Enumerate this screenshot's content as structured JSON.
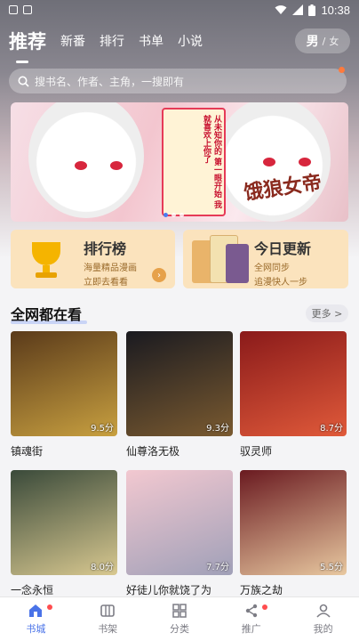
{
  "status_bar": {
    "time": "10:38"
  },
  "header": {
    "tabs": [
      {
        "label": "推荐",
        "active": true
      },
      {
        "label": "新番",
        "active": false
      },
      {
        "label": "排行",
        "active": false
      },
      {
        "label": "书单",
        "active": false
      },
      {
        "label": "小说",
        "active": false
      }
    ],
    "gender": {
      "male": "男",
      "separator": "/",
      "female": "女"
    }
  },
  "search": {
    "placeholder": "搜书名、作者、主角，一搜即有"
  },
  "banner": {
    "title_art": "饿狼女帝",
    "side_text": "从未知你的 第一眼开始 我就喜欢上你了"
  },
  "promos": [
    {
      "title": "排行榜",
      "line1": "海量精品漫画",
      "line2": "立即去看看"
    },
    {
      "title": "今日更新",
      "line1": "全网同步",
      "line2": "追漫快人一步"
    }
  ],
  "section": {
    "title": "全网都在看",
    "more": "更多 >"
  },
  "comics": [
    {
      "name": "镇魂街",
      "score": "9.5分",
      "colors": [
        "#5a3a1a",
        "#c8a040"
      ]
    },
    {
      "name": "仙尊洛无极",
      "score": "9.3分",
      "colors": [
        "#1a1a20",
        "#7a5a30"
      ]
    },
    {
      "name": "驭灵师",
      "score": "8.7分",
      "colors": [
        "#8a1a1a",
        "#e05a3a"
      ]
    },
    {
      "name": "一念永恒",
      "score": "8.0分",
      "colors": [
        "#3a4a3a",
        "#d8c890"
      ]
    },
    {
      "name": "好徒儿你就饶了为",
      "score": "7.7分",
      "colors": [
        "#f2c8d0",
        "#a0a0b8"
      ]
    },
    {
      "name": "万族之劫",
      "score": "5.5分",
      "colors": [
        "#6a1a20",
        "#e8c8a0"
      ]
    }
  ],
  "bottom_nav": [
    {
      "label": "书城",
      "active": true,
      "badge": true
    },
    {
      "label": "书架",
      "active": false,
      "badge": false
    },
    {
      "label": "分类",
      "active": false,
      "badge": false
    },
    {
      "label": "推广",
      "active": false,
      "badge": true
    },
    {
      "label": "我的",
      "active": false,
      "badge": false
    }
  ],
  "colors": {
    "accent": "#4a73e8",
    "badge": "#ff4d4f",
    "promo_bg": "#fbe3bd"
  }
}
